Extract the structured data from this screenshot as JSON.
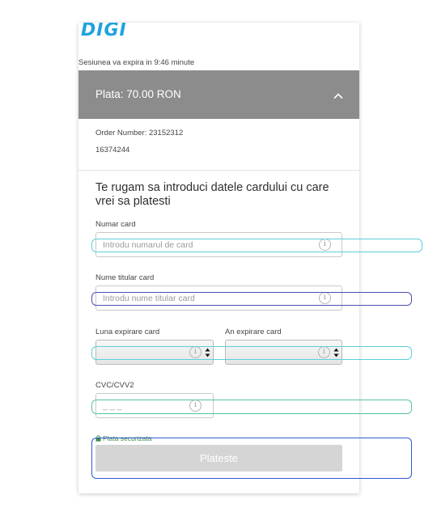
{
  "brand": {
    "logo_text": "DIGI",
    "color": "#1fa2e0"
  },
  "session": {
    "text": "Sesiunea va expira in 9:46 minute"
  },
  "payment": {
    "title": "Plata: 70.00 RON",
    "toggle_icon": "chevron-up-icon"
  },
  "order": {
    "number_line": "Order Number: 23152312",
    "second_line": "16374244"
  },
  "form": {
    "heading": "Te rugam sa introduci datele cardului cu care vrei sa platesti",
    "card_number": {
      "label": "Numar card",
      "placeholder": "Introdu numarul de card",
      "info_icon": "info-icon"
    },
    "holder_name": {
      "label": "Nume titular card",
      "placeholder": "Introdu nume titular card",
      "info_icon": "info-icon"
    },
    "exp_month": {
      "label": "Luna expirare card",
      "value": ""
    },
    "exp_year": {
      "label": "An expirare card",
      "value": ""
    },
    "cvc": {
      "label": "CVC/CVV2",
      "placeholder": "_ _ _"
    },
    "info_glyph": "i"
  },
  "secure": {
    "text": "Plata securizata",
    "icon": "lock-icon",
    "color": "#3f8b4c"
  },
  "submit": {
    "label": "Plateste",
    "color": "#d5d5d5"
  }
}
